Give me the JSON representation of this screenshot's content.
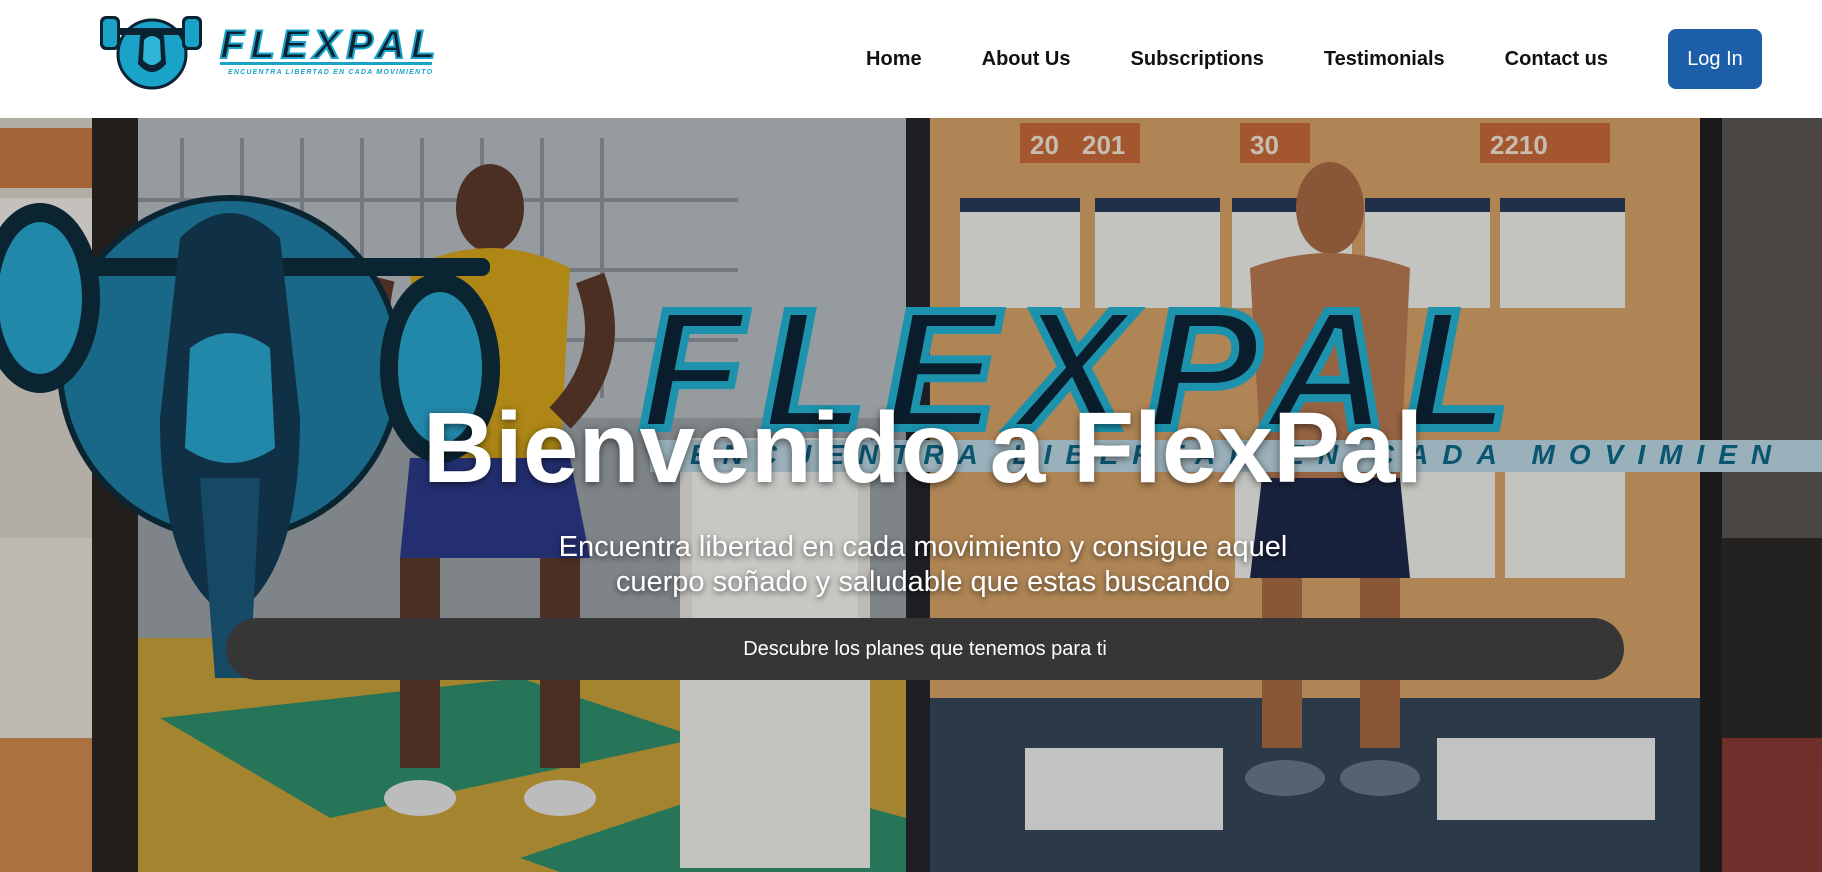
{
  "header": {
    "logo": {
      "wordmark": "FLEXPAL",
      "tagline": "ENCUENTRA LIBERTAD EN CADA MOVIMIENTO"
    },
    "nav": [
      {
        "label": "Home"
      },
      {
        "label": "About Us"
      },
      {
        "label": "Subscriptions"
      },
      {
        "label": "Testimonials"
      },
      {
        "label": "Contact us"
      }
    ],
    "login_label": "Log In"
  },
  "hero": {
    "title": "Bienvenido a FlexPal",
    "subtitle_line1": "Encuentra libertad en cada movimiento y consigue aquel",
    "subtitle_line2": "cuerpo soñado y saludable que estas buscando",
    "cta_label": "Descubre los planes que tenemos para ti",
    "background": {
      "banner_wordmark": "FLEXPAL",
      "banner_tagline": "ENCUENTRA LIBERTAD EN CADA MOVIMIEN",
      "calendar_numbers": [
        "20",
        "201",
        "30",
        "2210"
      ]
    }
  },
  "colors": {
    "accent": "#1d5ea8",
    "brand_cyan": "#1aa3c8",
    "brand_dark": "#0b2233",
    "cta_bg": "#363636"
  }
}
